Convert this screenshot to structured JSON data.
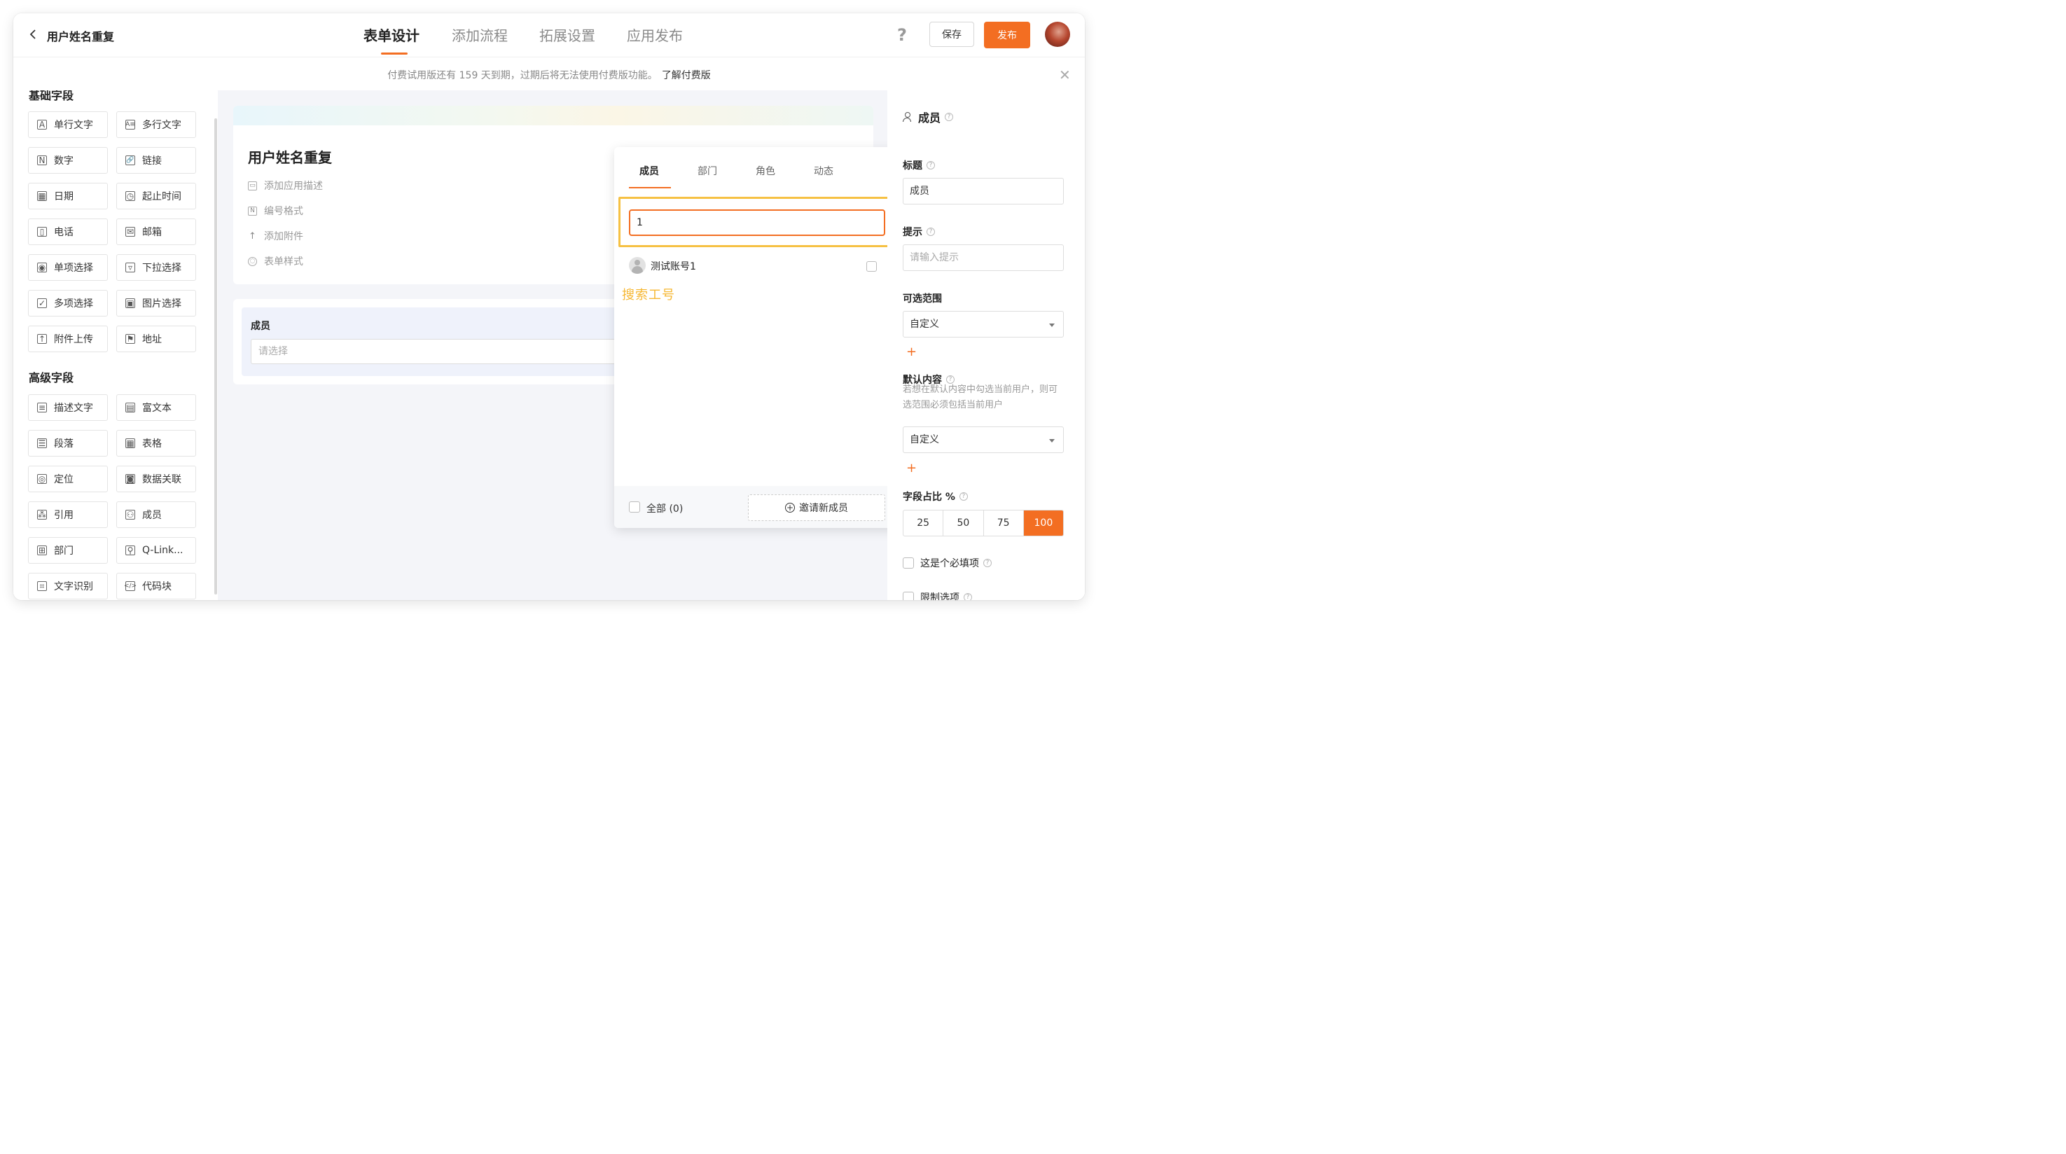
{
  "header": {
    "app_title": "用户姓名重复",
    "tabs": [
      {
        "label": "表单设计",
        "active": true
      },
      {
        "label": "添加流程",
        "active": false
      },
      {
        "label": "拓展设置",
        "active": false
      },
      {
        "label": "应用发布",
        "active": false
      }
    ],
    "help_icon": "question-icon",
    "save_label": "保存",
    "publish_label": "发布"
  },
  "banner": {
    "text": "付费试用版还有 159 天到期，过期后将无法使用付费版功能。",
    "link": "了解付费版"
  },
  "left_panel": {
    "basic_title": "基础字段",
    "basic_fields": [
      {
        "label": "单行文字",
        "icon": "A"
      },
      {
        "label": "多行文字",
        "icon": "A≡"
      },
      {
        "label": "数字",
        "icon": "N"
      },
      {
        "label": "链接",
        "icon": "🔗"
      },
      {
        "label": "日期",
        "icon": "▦"
      },
      {
        "label": "起止时间",
        "icon": "◷"
      },
      {
        "label": "电话",
        "icon": "▯"
      },
      {
        "label": "邮箱",
        "icon": "✉"
      },
      {
        "label": "单项选择",
        "icon": "◉"
      },
      {
        "label": "下拉选择",
        "icon": "▿"
      },
      {
        "label": "多项选择",
        "icon": "✓"
      },
      {
        "label": "图片选择",
        "icon": "▣"
      },
      {
        "label": "附件上传",
        "icon": "↑"
      },
      {
        "label": "地址",
        "icon": "⚑"
      }
    ],
    "advanced_title": "高级字段",
    "advanced_fields": [
      {
        "label": "描述文字",
        "icon": "≡"
      },
      {
        "label": "富文本",
        "icon": "▤"
      },
      {
        "label": "段落",
        "icon": "☰"
      },
      {
        "label": "表格",
        "icon": "▦"
      },
      {
        "label": "定位",
        "icon": "◎"
      },
      {
        "label": "数据关联",
        "icon": "◙"
      },
      {
        "label": "引用",
        "icon": "⁂"
      },
      {
        "label": "成员",
        "icon": "⚇"
      },
      {
        "label": "部门",
        "icon": "⊞"
      },
      {
        "label": "Q-Link...",
        "icon": "⚲"
      },
      {
        "label": "文字识别",
        "icon": "⌗"
      },
      {
        "label": "代码块",
        "icon": "</>"
      }
    ]
  },
  "canvas": {
    "form_title": "用户姓名重复",
    "meta_items": [
      {
        "label": "添加应用描述",
        "icon": "▭"
      },
      {
        "label": "编号格式",
        "icon": "N"
      },
      {
        "label": "添加附件",
        "icon": "↑"
      },
      {
        "label": "表单样式",
        "icon": "◌"
      }
    ],
    "member_field": {
      "label": "成员",
      "placeholder": "请选择"
    }
  },
  "popup": {
    "tabs": [
      {
        "label": "成员",
        "active": true
      },
      {
        "label": "部门",
        "active": false
      },
      {
        "label": "角色",
        "active": false
      },
      {
        "label": "动态",
        "active": false
      }
    ],
    "search_value": "1",
    "results": [
      {
        "name": "测试账号1",
        "checked": false
      }
    ],
    "annotation": "搜索工号",
    "select_all_label": "全部 (0)",
    "invite_label": "邀请新成员"
  },
  "right_panel": {
    "header": "成员",
    "title_label": "标题",
    "title_value": "成员",
    "hint_label": "提示",
    "hint_placeholder": "请输入提示",
    "range_label": "可选范围",
    "range_value": "自定义",
    "default_label": "默认内容",
    "default_hint": "若想在默认内容中勾选当前用户，则可选范围必须包括当前用户",
    "default_value": "自定义",
    "ratio_label": "字段占比 %",
    "ratio_options": [
      "25",
      "50",
      "75",
      "100"
    ],
    "ratio_selected": "100",
    "required_label": "这是个必填项",
    "limit_label": "限制选项"
  },
  "colors": {
    "accent": "#f36e22",
    "annotation": "#f6b732"
  }
}
